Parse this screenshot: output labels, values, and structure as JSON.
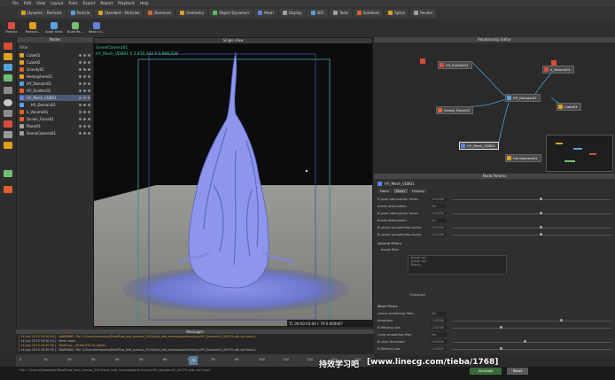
{
  "menu": [
    "File",
    "Edit",
    "View",
    "Layout",
    "Tools",
    "Export",
    "Report",
    "Playback",
    "Help"
  ],
  "shelf_tabs": [
    {
      "label": "Dynamic - Particles",
      "color": "#e0a020"
    },
    {
      "label": "Particle",
      "color": "#58a0e0"
    },
    {
      "label": "Standard - Particles",
      "color": "#e0a020"
    },
    {
      "label": "Daemons",
      "color": "#e06030"
    },
    {
      "label": "Geometry",
      "color": "#e0a020"
    },
    {
      "label": "Object Dynamics",
      "color": "#58c060"
    },
    {
      "label": "Mesh",
      "color": "#6080e0"
    },
    {
      "label": "Display",
      "color": "#a0a0a0"
    },
    {
      "label": "SDC",
      "color": "#58a0e0"
    },
    {
      "label": "Tools",
      "color": "#a0a0a0"
    },
    {
      "label": "Solutions",
      "color": "#e06030"
    },
    {
      "label": "Splice",
      "color": "#e0a020"
    },
    {
      "label": "Render",
      "color": "#a0a0a0"
    }
  ],
  "tools": [
    "Particle",
    "Particle...",
    "Audit Helix",
    "Build Re...",
    "Mesh nu..."
  ],
  "nodes_panel": {
    "title": "Nodes",
    "filter_label": "Filter",
    "items": [
      {
        "label": "Cube01",
        "color": "#e0a020"
      },
      {
        "label": "Cube02",
        "color": "#e0a020"
      },
      {
        "label": "Gravity01",
        "color": "#e06030"
      },
      {
        "label": "Hemisphere01",
        "color": "#e0a020"
      },
      {
        "label": "HY_Domain01",
        "color": "#58a0e0"
      },
      {
        "label": "HY_Emitter01",
        "color": "#e06030"
      },
      {
        "label": "HY_Mesh_VDB01",
        "color": "#6080e0"
      },
      {
        "label": "HY_Domain01",
        "color": "#58a0e0"
      },
      {
        "label": "k_Volume01",
        "color": "#e06030"
      },
      {
        "label": "Ocean_Force01",
        "color": "#e06030"
      },
      {
        "label": "Plane01",
        "color": "#a0a0a0"
      },
      {
        "label": "SceneCamera01",
        "color": "#a0a0a0"
      }
    ]
  },
  "viewport": {
    "title": "Single View",
    "camera_label": "SceneCamera01",
    "mesh_info": "HY_Mesh_VDB01 V 2,830,402 F 5,660,228",
    "timecode": "TC 00:00:03:04  F 79  0.000067",
    "end_value": "00 00"
  },
  "relationship": {
    "title": "Relationship Editor",
    "nodes": [
      "HY_Emitter01",
      "HY_Domain01",
      "Ocean_Force01",
      "k_Volume01",
      "Cube01",
      "HY_Mesh_VDB01",
      "Hemisphere01"
    ]
  },
  "params": {
    "title": "Node Params",
    "node_name": "HY_Mesh_VDB01",
    "tabs": [
      "Node",
      "Mesh",
      "Display"
    ],
    "rows": [
      {
        "label": "B-pixel attenuation factor",
        "value": "1.00000",
        "slider": 0.55
      },
      {
        "label": "Inside attenuation",
        "value": "Yes"
      },
      {
        "label": "B-pixel attenuation factor",
        "value": "1.00000",
        "slider": 0.55
      },
      {
        "label": "Inside attenuation",
        "value": "Yes"
      },
      {
        "label": "B-vector smoothness factor",
        "value": "1.00000",
        "slider": 0.55
      },
      {
        "label": "B-vector smoothness factor",
        "value": "1.00000",
        "slider": 0.55
      }
    ],
    "volume_section": "Volume Filters",
    "volume_label": "Inside filter",
    "volume_items": [
      "Erode vol...",
      "Dilate vol...",
      "Blend..."
    ],
    "threshold_label": "Threshold",
    "mesh_section": "Mesh Filters",
    "mesh_rows": [
      {
        "label": "Linear smoothing filter",
        "value": "Yes"
      },
      {
        "label": "Iterations",
        "value": "1.00000",
        "slider": 0.68
      },
      {
        "label": "B-filtering size",
        "value": "1.00000",
        "slider": 0.3
      },
      {
        "label": "Cone smoothing filter",
        "value": "Yes"
      },
      {
        "label": "B-cone threshold",
        "value": "1.00000",
        "slider": 0.45
      },
      {
        "label": "B-filtering size",
        "value": "1.00000",
        "slider": 0.3
      }
    ]
  },
  "messages": {
    "title": "Messages",
    "lines": [
      "[ 16 July 2013 18:30:54 ] : WARNING: File 'C/Users/fanbaohui/RealFlow_test_scenes_2013/test_vdb_meshes/particles/cyc/HY_Domain01_00079.vdb not found.",
      "[ 16 July 2013 18:30:54 ] : Mesh done.",
      "[ 16 July 2013 18:30:55 ] : Meshing... (Press ESC to abort)",
      "[ 16 July 2013 18:30:55 ] : WARNING: File 'C/Users/fanbaohui/RealFlow_test_scenes_2013/test_vdb_meshes/particles/cyc/HY_Domain01_00079.vdb not found."
    ]
  },
  "timeline": {
    "current_frame": "79",
    "ticks": [
      "0",
      "10",
      "20",
      "30",
      "40",
      "50",
      "60",
      "70",
      "79",
      "90",
      "100",
      "110",
      "120",
      "130",
      "140"
    ]
  },
  "status": {
    "path": "File: 'C/Users/fanbaohui/RealFlow_test_scenes_2013/test_vdb_meshes/particles/cyc/HY_Domain01_00079.vdb not found",
    "simulate_label": "Simulate",
    "reset_label": "Reset",
    "watermark": "[www.linecg.com/tieba/1768]",
    "watermark_cn": "持效学习吧"
  }
}
